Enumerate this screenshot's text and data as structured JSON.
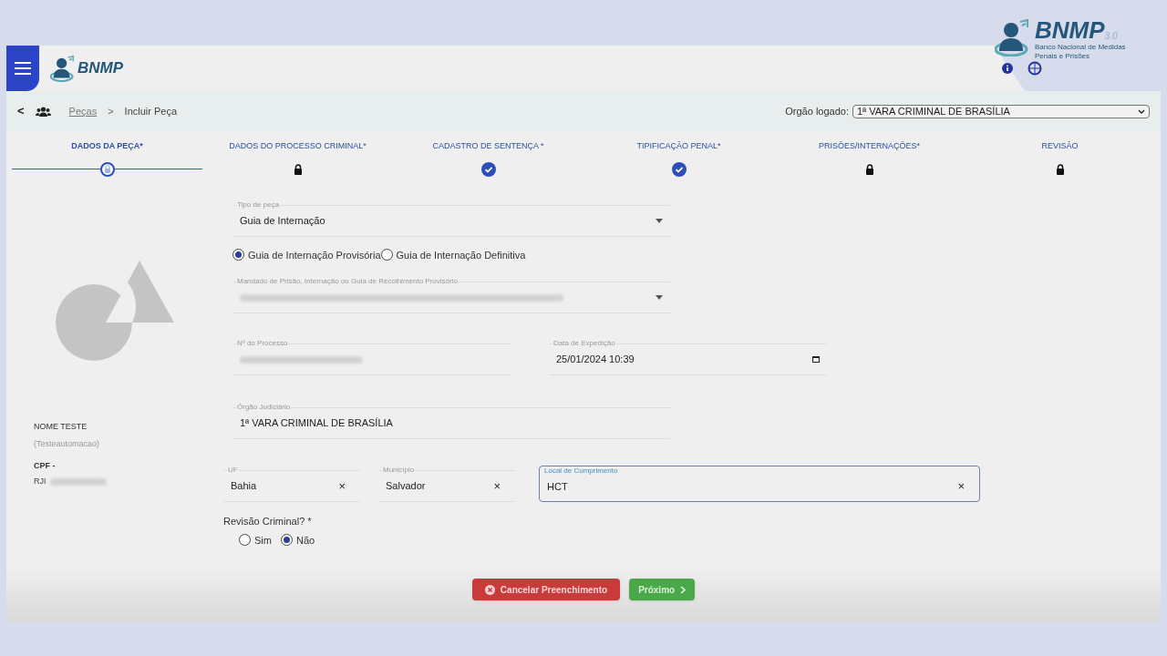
{
  "header": {
    "logo_text": "BNMP",
    "corner_logo": {
      "name": "BNMP",
      "version": "3.0",
      "subtitle": "Banco Nacional de Medidas Penais e Prisões"
    }
  },
  "breadcrumb": {
    "items": [
      {
        "label": "Peças",
        "kind": "link"
      },
      {
        "label": "Incluir Peça",
        "kind": "current"
      }
    ],
    "separator": ">",
    "back": "<"
  },
  "orgao": {
    "label": "Orgão logado:",
    "value": "1ª VARA CRIMINAL DE BRASÍLIA"
  },
  "steps": [
    {
      "label": "DADOS DA PEÇA*",
      "kind": "current",
      "selected": true
    },
    {
      "label": "DADOS DO PROCESSO CRIMINAL*",
      "kind": "locked",
      "selected": false
    },
    {
      "label": "CADASTRO DE SENTENÇA *",
      "kind": "done",
      "selected": false
    },
    {
      "label": "TIPIFICAÇÃO PENAL*",
      "kind": "done",
      "selected": false
    },
    {
      "label": "PRISÕES/INTERNAÇÕES*",
      "kind": "locked",
      "selected": false
    },
    {
      "label": "REVISÃO",
      "kind": "locked",
      "selected": false
    }
  ],
  "person": {
    "name": "NOME TESTE",
    "user": "(Testeautomacao)",
    "cpf": "CPF -",
    "rji": "RJI"
  },
  "form": {
    "tipo": {
      "label": "Tipo de peça",
      "value": "Guia de Internação"
    },
    "guia_options": [
      {
        "label": "Guia de Internação Provisória",
        "selected": true
      },
      {
        "label": "Guia de Internação Definitiva",
        "selected": false
      }
    ],
    "mandado": {
      "label": "Mandado de Prisão, Internação ou Guia de Recolhimento Provisório"
    },
    "processo": {
      "label": "Nº do Processo"
    },
    "data": {
      "label": "Data de Expedição",
      "value": "25/01/2024 10:39"
    },
    "orgao_judiciario": {
      "label": "Órgão Judiciário",
      "value": "1ª VARA CRIMINAL DE BRASÍLIA"
    },
    "uf": {
      "label": "UF",
      "value": "Bahia",
      "clear": "×",
      "focused": false
    },
    "municipio": {
      "label": "Município",
      "value": "Salvador",
      "clear": "×",
      "focused": false
    },
    "local": {
      "label": "Local de Cumprimento",
      "value": "HCT",
      "clear": "×",
      "focused": true
    },
    "revisao": {
      "label": "Revisão Criminal? *",
      "options": [
        {
          "label": "Sim",
          "selected": false
        },
        {
          "label": "Não",
          "selected": true
        }
      ]
    }
  },
  "buttons": [
    {
      "label": "Cancelar Preenchimento",
      "kind": "cancel"
    },
    {
      "label": "Próximo",
      "kind": "next"
    }
  ]
}
